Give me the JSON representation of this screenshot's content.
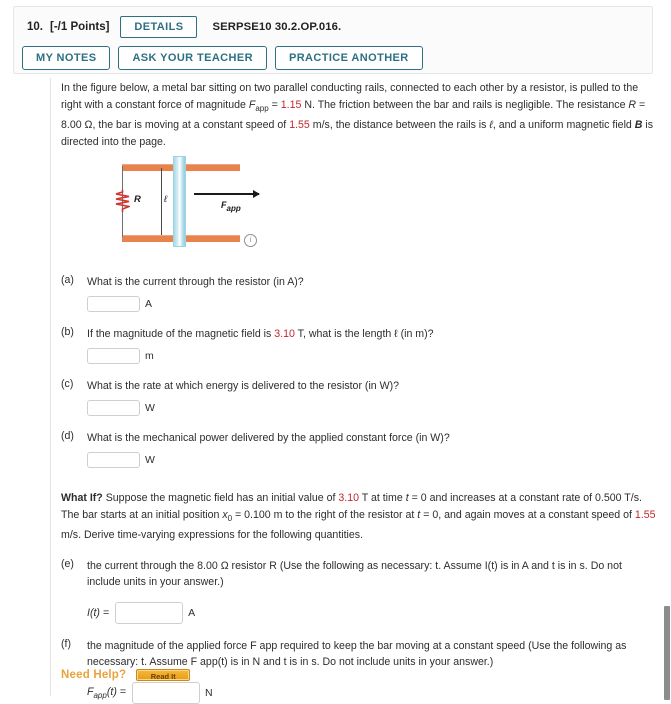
{
  "header": {
    "question_number": "10.",
    "points": "[-/1 Points]",
    "details_label": "DETAILS",
    "source_code": "SERPSE10 30.2.OP.016.",
    "my_notes_label": "MY NOTES",
    "ask_teacher_label": "ASK YOUR TEACHER",
    "practice_another_label": "PRACTICE ANOTHER",
    "accent_color": "#2d7083"
  },
  "intro": {
    "line1_a": "In the figure below, a metal bar sitting on two parallel conducting rails, connected to each other by a resistor, is pulled to the right with a constant force of magnitude ",
    "force_symbol": "F",
    "force_sub": "app",
    "eq1": " = ",
    "force_value": "1.15",
    "line1_b": " N. The friction between the bar and rails is negligible. The resistance ",
    "resistance_symbol": "R",
    "eq2": " = ",
    "resistance_value": "8.00 Ω",
    "line2_a": ", the bar is moving at a constant speed of ",
    "speed_value": "1.55",
    "line2_b": " m/s, the distance between the rails is ",
    "ell_symbol": "ℓ",
    "line2_c": ", and a uniform magnetic field ",
    "b_symbol": "B",
    "line2_d": " is directed into the page."
  },
  "figure": {
    "resistor_label": "R",
    "length_label": "ℓ",
    "velocity_label_main": "F",
    "velocity_label_sub": "app",
    "info_icon_glyph": "i",
    "rail_color": "#e8834e",
    "bar_color": "#a8dbe8",
    "resistor_color": "#d0342c"
  },
  "parts": [
    {
      "label": "(a)",
      "question": "What is the current through the resistor (in A)?",
      "value": "",
      "unit": "A"
    },
    {
      "label": "(b)",
      "question_pre": "If the magnitude of the magnetic field is ",
      "highlight": "3.10",
      "question_post": " T, what is the length ℓ (in m)?",
      "question": "If the magnitude of the magnetic field is 3.10 T, what is the length ℓ (in m)?",
      "value": "",
      "unit": "m"
    },
    {
      "label": "(c)",
      "question": "What is the rate at which energy is delivered to the resistor (in W)?",
      "value": "",
      "unit": "W"
    },
    {
      "label": "(d)",
      "question": "What is the mechanical power delivered by the applied constant force (in W)?",
      "value": "",
      "unit": "W"
    }
  ],
  "what_if": {
    "title": "What If?",
    "text_a": " Suppose the magnetic field has an initial value of ",
    "b_value": "3.10",
    "text_b": " T at time ",
    "t_symbol": "t",
    "text_c": " = 0 and increases at a constant rate of 0.500 T/s. The bar starts at an initial position ",
    "x_symbol": "x",
    "x_sub": "0",
    "text_d": " = 0.100 m to the right of the resistor at ",
    "t_symbol2": "t",
    "text_e": " = 0, and again moves at a constant speed of ",
    "speed_value": "1.55",
    "text_f": " m/s. Derive time-varying expressions for the following quantities."
  },
  "part_e": {
    "label": "(e)",
    "question": "the current through the 8.00 Ω resistor R (Use the following as necessary: t. Assume I(t) is in A and t is in s. Do not include units in your answer.)",
    "lhs_main": "I",
    "lhs_rest": "(t) =",
    "value": "",
    "unit": "A"
  },
  "part_f": {
    "label": "(f)",
    "question": "the magnitude of the applied force F app required to keep the bar moving at a constant speed (Use the following as necessary: t. Assume F app(t) is in N and t is in s. Do not include units in your answer.)",
    "lhs_main": "F",
    "lhs_sub": "app",
    "lhs_rest": "(t) =",
    "value": "",
    "unit": "N"
  },
  "need_help": {
    "label": "Need Help?",
    "read_it_label": "Read It",
    "color": "#e8a33d"
  }
}
